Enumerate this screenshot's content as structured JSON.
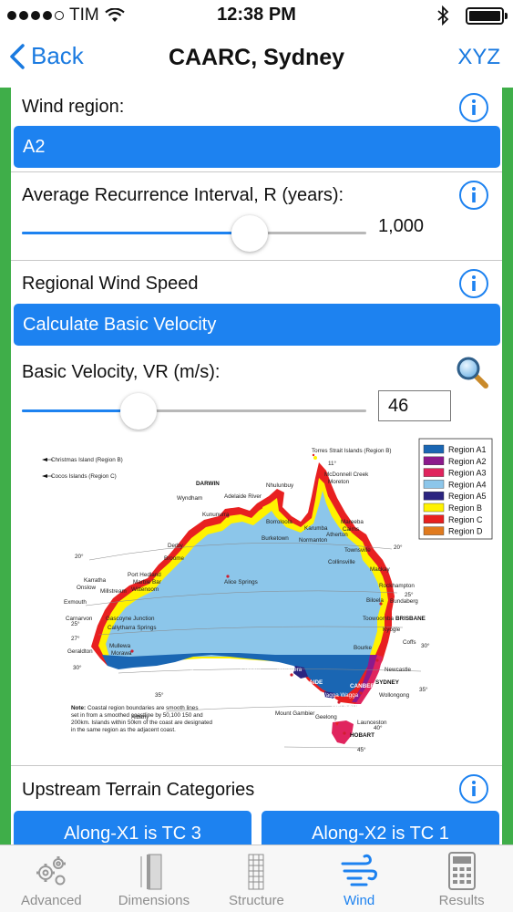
{
  "status_bar": {
    "carrier": "TIM",
    "time": "12:38 PM"
  },
  "nav": {
    "back_label": "Back",
    "title": "CAARC, Sydney",
    "right_label": "XYZ"
  },
  "wind_region": {
    "label": "Wind region:",
    "value": "A2"
  },
  "recurrence": {
    "label": "Average Recurrence Interval, R (years):",
    "value": "1,000",
    "slider_fraction": 0.68
  },
  "regional_speed": {
    "label": "Regional Wind Speed",
    "button_label": "Calculate Basic Velocity"
  },
  "basic_velocity": {
    "label": "Basic Velocity, VR (m/s):",
    "value": "46",
    "slider_fraction": 0.32
  },
  "map": {
    "top_note": "Torres Strait Islands (Region B)",
    "christmas_island": "Christmas Island (Region B)",
    "cocos_islands": "Cocos Islands (Region C)",
    "legend": [
      {
        "label": "Region A1",
        "color": "#1a66b3"
      },
      {
        "label": "Region A2",
        "color": "#8c1a8c"
      },
      {
        "label": "Region A3",
        "color": "#e0245e"
      },
      {
        "label": "Region A4",
        "color": "#8cc6ea"
      },
      {
        "label": "Region A5",
        "color": "#2b2480"
      },
      {
        "label": "Region B",
        "color": "#fff200"
      },
      {
        "label": "Region C",
        "color": "#e82020"
      },
      {
        "label": "Region D",
        "color": "#e07a1e"
      }
    ],
    "places": {
      "darwin": "DARWIN",
      "nhulunbuy": "Nhulunbuy",
      "adelaide_river": "Adelaide River",
      "wyndham": "Wyndham",
      "kununurra": "Kununurra",
      "borroloola": "Borroloola",
      "burketown": "Burketown",
      "normanton": "Normanton",
      "mcdonnel": "McDonnell Creek",
      "moreton": "Moreton",
      "mareeba": "Mareeba",
      "cairns": "Cairns",
      "atherton": "Atherton",
      "karumba": "Karumba",
      "townsville": "Townsville",
      "collinsville": "Collinsville",
      "mackay": "Mackay",
      "rockhampton": "Rockhampton",
      "biloela": "Biloela",
      "bundaberg": "Bundaberg",
      "toowoomba": "Toowoomba",
      "brisbane": "BRISBANE",
      "kyogle": "Kyogle",
      "coffs": "Coffs",
      "derby": "Derby",
      "broome": "Broome",
      "port_hedland": "Port Hedland",
      "marble_bar": "Marble Bar",
      "karratha": "Karratha",
      "onslow": "Onslow",
      "millstream": "Millstream",
      "wittenoom": "Wittenoom",
      "exmouth": "Exmouth",
      "carnarvon": "Carnarvon",
      "gascoyne": "Gascoyne Junction",
      "callytharra": "Callytharra Springs",
      "geraldton": "Geraldton",
      "mullewa": "Mullewa",
      "morawa": "Morawa",
      "perth": "PERTH",
      "alice": "Alice Springs",
      "bourke": "Bourke",
      "kalgoorlie": "Kalgoorlie",
      "esperance": "Esperance",
      "albany": "Albany",
      "ceduna": "Ceduna",
      "woomera": "Woomera",
      "adelaide": "ADELAIDE",
      "canberra": "CANBERRA",
      "sydney": "SYDNEY",
      "newcastle": "Newcastle",
      "wollongong": "Wollongong",
      "wagga": "Wagga Wagga",
      "melbourne": "MELBOURNE",
      "geelong": "Geelong",
      "mount_gambier": "Mount Gambier",
      "launceston": "Launceston",
      "hobart": "HOBART"
    },
    "latitudes": {
      "l11": "11°",
      "l20a": "20°",
      "l20b": "20°",
      "l25a": "25°",
      "l25b": "25°",
      "l27": "27°",
      "l30a": "30°",
      "l30b": "30°",
      "l35a": "35°",
      "l35b": "35°",
      "l40": "40°",
      "l45": "45°"
    },
    "note_bold": "Note:",
    "note_lines": [
      "Coastal region boundaries are smooth lines",
      "set in from a smoothed coastline by 50,100 150 and",
      "200km. Islands within 50km of the coast are designated",
      "in the same region as the adjacent coast."
    ]
  },
  "terrain": {
    "label": "Upstream Terrain Categories",
    "button_x1": "Along-X1 is TC 3",
    "button_x2": "Along-X2 is TC 1"
  },
  "tabs": [
    {
      "label": "Advanced",
      "icon": "gears-icon"
    },
    {
      "label": "Dimensions",
      "icon": "building-dimensions-icon"
    },
    {
      "label": "Structure",
      "icon": "building-structure-icon"
    },
    {
      "label": "Wind",
      "icon": "wind-icon"
    },
    {
      "label": "Results",
      "icon": "calculator-icon"
    }
  ],
  "colors": {
    "accent": "#1d82f0",
    "frame_green": "#3fae49"
  }
}
